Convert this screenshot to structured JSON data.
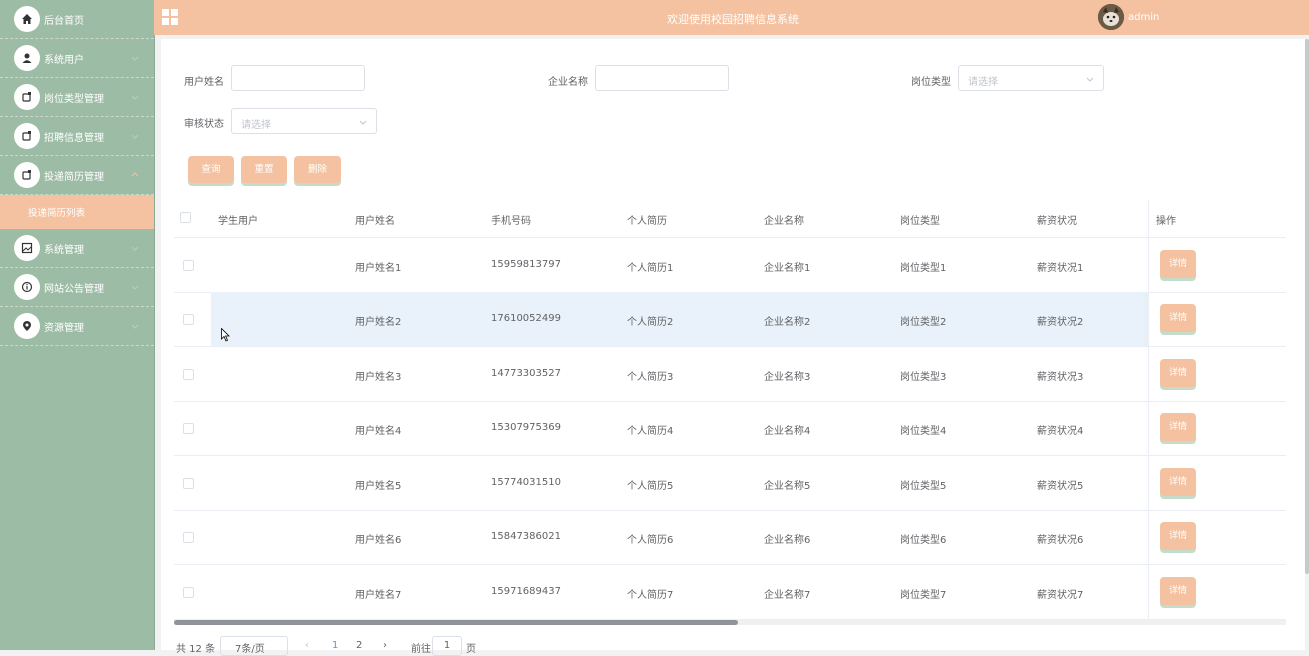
{
  "header": {
    "title": "欢迎使用校园招聘信息系统",
    "username": "admin"
  },
  "sidebar": {
    "items": [
      {
        "label": "后台首页",
        "icon": "home-icon"
      },
      {
        "label": "系统用户",
        "icon": "user-icon"
      },
      {
        "label": "岗位类型管理",
        "icon": "module-icon"
      },
      {
        "label": "招聘信息管理",
        "icon": "module-icon"
      },
      {
        "label": "投递简历管理",
        "icon": "module-icon"
      },
      {
        "label": "系统管理",
        "icon": "image-icon"
      },
      {
        "label": "网站公告管理",
        "icon": "info-icon"
      },
      {
        "label": "资源管理",
        "icon": "location-icon"
      }
    ],
    "submenu": {
      "label": "投递简历列表"
    }
  },
  "filters": {
    "username_label": "用户姓名",
    "company_label": "企业名称",
    "position_label": "岗位类型",
    "position_placeholder": "请选择",
    "status_label": "审核状态",
    "status_placeholder": "请选择"
  },
  "buttons": {
    "query": "查询",
    "reset": "重置",
    "delete": "删除"
  },
  "table": {
    "columns": [
      "学生用户",
      "用户姓名",
      "手机号码",
      "个人简历",
      "企业名称",
      "岗位类型",
      "薪资状况",
      "操作"
    ],
    "detail_label": "详情",
    "rows": [
      {
        "name": "用户姓名1",
        "phone": "15959813797",
        "resume": "个人简历1",
        "company": "企业名称1",
        "position": "岗位类型1",
        "salary": "薪资状况1"
      },
      {
        "name": "用户姓名2",
        "phone": "17610052499",
        "resume": "个人简历2",
        "company": "企业名称2",
        "position": "岗位类型2",
        "salary": "薪资状况2"
      },
      {
        "name": "用户姓名3",
        "phone": "14773303527",
        "resume": "个人简历3",
        "company": "企业名称3",
        "position": "岗位类型3",
        "salary": "薪资状况3"
      },
      {
        "name": "用户姓名4",
        "phone": "15307975369",
        "resume": "个人简历4",
        "company": "企业名称4",
        "position": "岗位类型4",
        "salary": "薪资状况4"
      },
      {
        "name": "用户姓名5",
        "phone": "15774031510",
        "resume": "个人简历5",
        "company": "企业名称5",
        "position": "岗位类型5",
        "salary": "薪资状况5"
      },
      {
        "name": "用户姓名6",
        "phone": "15847386021",
        "resume": "个人简历6",
        "company": "企业名称6",
        "position": "岗位类型6",
        "salary": "薪资状况6"
      },
      {
        "name": "用户姓名7",
        "phone": "15971689437",
        "resume": "个人简历7",
        "company": "企业名称7",
        "position": "岗位类型7",
        "salary": "薪资状况7"
      }
    ]
  },
  "pagination": {
    "total": "共 12 条",
    "page_size": "7条/页",
    "pages": [
      "1",
      "2"
    ],
    "goto_label": "前往",
    "goto_value": "1",
    "page_unit": "页"
  },
  "colors": {
    "sidebar_bg": "#9dbca6",
    "accent": "#f5c2a1",
    "row_highlight": "#e9f2fa"
  }
}
